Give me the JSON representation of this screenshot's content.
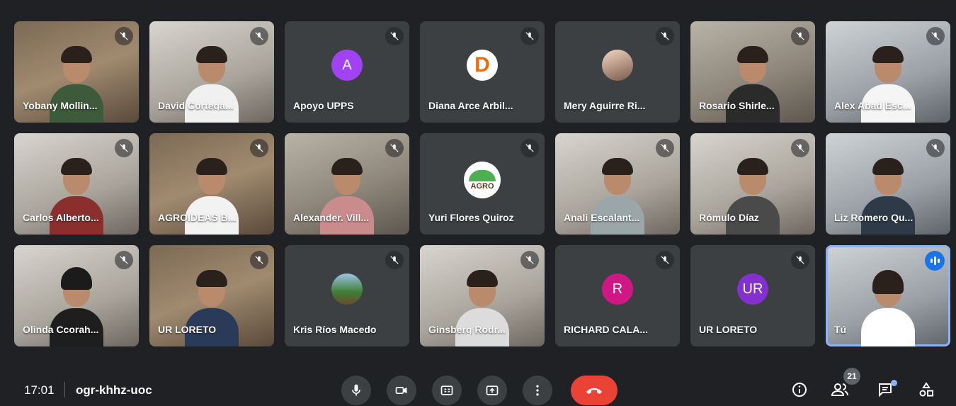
{
  "tiles": [
    {
      "name": "Yobany Mollin...",
      "kind": "video",
      "muted": true
    },
    {
      "name": "David Cortega...",
      "kind": "video",
      "muted": true
    },
    {
      "name": "Apoyo UPPS",
      "kind": "initial",
      "initial": "A",
      "color": "#a142f4",
      "muted": true
    },
    {
      "name": "Diana Arce Arbil...",
      "kind": "logo",
      "initial": "D",
      "muted": true
    },
    {
      "name": "Mery Aguirre Ri...",
      "kind": "photo",
      "muted": true
    },
    {
      "name": "Rosario Shirle...",
      "kind": "video",
      "muted": true
    },
    {
      "name": "Alex Abad Esc...",
      "kind": "video",
      "muted": true
    },
    {
      "name": "Carlos Alberto...",
      "kind": "video",
      "muted": true
    },
    {
      "name": "AGROIDEAS B...",
      "kind": "video",
      "muted": true
    },
    {
      "name": "Alexander. Vill...",
      "kind": "video",
      "muted": true
    },
    {
      "name": "Yuri Flores Quiroz",
      "kind": "agro",
      "initial": "AGRO",
      "muted": true
    },
    {
      "name": "Anali Escalant...",
      "kind": "video",
      "muted": true
    },
    {
      "name": "Rómulo Díaz",
      "kind": "video",
      "muted": true
    },
    {
      "name": "Liz Romero Qu...",
      "kind": "video",
      "muted": true
    },
    {
      "name": "Olinda Ccorah...",
      "kind": "video",
      "muted": true
    },
    {
      "name": "UR LORETO",
      "kind": "video",
      "muted": true
    },
    {
      "name": "Kris Ríos Macedo",
      "kind": "photo-tree",
      "muted": true
    },
    {
      "name": "Ginsberg Rodr...",
      "kind": "video",
      "muted": true
    },
    {
      "name": "RICHARD CALA...",
      "kind": "initial",
      "initial": "R",
      "color": "#d01884",
      "muted": true
    },
    {
      "name": "UR LORETO",
      "kind": "initial",
      "initial": "UR",
      "color": "#8430ce",
      "muted": true
    },
    {
      "name": "Tú",
      "kind": "video",
      "muted": false,
      "speaking": true
    }
  ],
  "bottom": {
    "time": "17:01",
    "meeting_code": "ogr-khhz-uoc",
    "participant_count": "21",
    "colors": {
      "end_call": "#ea4335",
      "accent": "#8ab4f8"
    }
  }
}
